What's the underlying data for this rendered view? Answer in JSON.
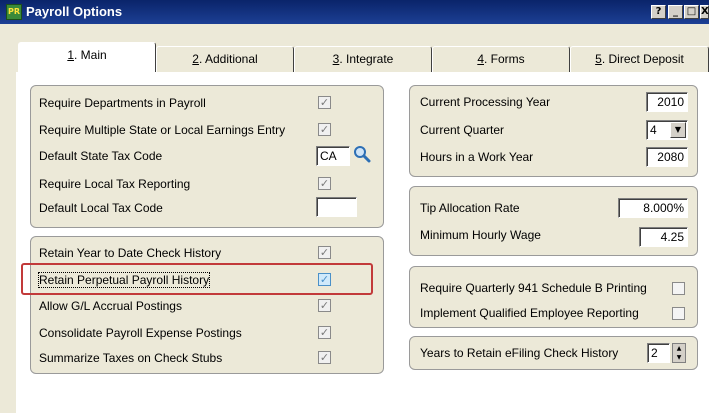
{
  "window": {
    "title": "Payroll Options",
    "icon_glyph": "PR",
    "help_glyph": "?",
    "minimize_glyph": "_",
    "maximize_glyph": "□",
    "close_glyph": "X"
  },
  "tabs": [
    {
      "key": "1",
      "label": ". Main",
      "active": true
    },
    {
      "key": "2",
      "label": ". Additional",
      "active": false
    },
    {
      "key": "3",
      "label": ". Integrate",
      "active": false
    },
    {
      "key": "4",
      "label": ". Forms",
      "active": false
    },
    {
      "key": "5",
      "label": ". Direct Deposit",
      "active": false
    }
  ],
  "left_group1": {
    "req_departments": "Require Departments in Payroll",
    "req_multi_state": "Require Multiple State or Local Earnings Entry",
    "default_state_tax": "Default State Tax Code",
    "default_state_tax_value": "CA",
    "req_local_tax": "Require Local Tax Reporting",
    "default_local_tax": "Default Local Tax Code",
    "default_local_tax_value": ""
  },
  "left_group2": {
    "retain_ytd": "Retain Year to Date Check History",
    "retain_perpetual": "Retain Perpetual Payroll History",
    "allow_gl_accrual": "Allow G/L Accrual Postings",
    "consolidate": "Consolidate Payroll Expense Postings",
    "summarize": "Summarize Taxes on Check Stubs"
  },
  "right_group1": {
    "current_year_label": "Current Processing Year",
    "current_year_value": "2010",
    "current_quarter_label": "Current Quarter",
    "current_quarter_value": "4",
    "hours_label": "Hours in a Work Year",
    "hours_value": "2080"
  },
  "right_group2": {
    "tip_label": "Tip Allocation Rate",
    "tip_value": "8.000%",
    "min_wage_label": "Minimum Hourly Wage",
    "min_wage_value": "4.25"
  },
  "right_group3": {
    "schedule_b_label": "Require Quarterly 941 Schedule B Printing",
    "qualified_label": "Implement Qualified Employee Reporting"
  },
  "right_group4": {
    "efiling_label": "Years to Retain eFiling Check History",
    "efiling_value": "2"
  },
  "glyphs": {
    "check": "✓",
    "dropdown": "▼",
    "spin_up": "▲",
    "spin_down": "▼"
  },
  "colors": {
    "titlebar": "#0a246a",
    "highlight": "#c23a3a",
    "focus_check": "#4a90c8"
  }
}
